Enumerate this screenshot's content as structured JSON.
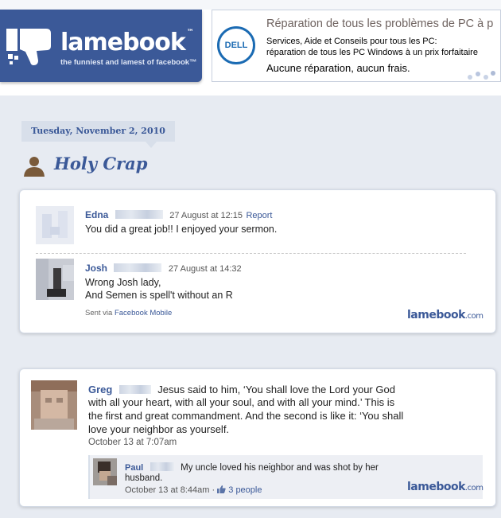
{
  "header": {
    "logo_text": "lamebook",
    "logo_tm": "™",
    "tagline": "the funniest and lamest of facebook™",
    "accent": "#3b5998"
  },
  "ad": {
    "brand": "DELL",
    "title": "Réparation de tous les problèmes de PC à p",
    "line1": "Services, Aide et Conseils pour tous les PC:",
    "line2": "réparation de tous les PC Windows à un prix forfaitaire",
    "cta": "Aucune réparation, aucun frais."
  },
  "post": {
    "date": "Tuesday, November 2, 2010",
    "title": "Holy Crap",
    "icon": "person-silhouette-icon"
  },
  "card1": {
    "comment1": {
      "name": "Edna",
      "time": "27 August at 12:15",
      "report": "Report",
      "text": "You did a great job!! I enjoyed your sermon."
    },
    "comment2": {
      "name": "Josh",
      "time": "27 August at 14:32",
      "line1": "Wrong Josh lady,",
      "line2": "And Semen is spell't without an R"
    },
    "sent_via": "Sent via",
    "sent_link": "Facebook Mobile",
    "watermark": "lamebook",
    "watermark_suffix": ".com"
  },
  "card2": {
    "status": {
      "name": "Greg",
      "text_first": "Jesus said to him, ‘You shall love the Lord your God",
      "text_lines": [
        "with all your heart, with all your soul, and with all your mind.’ This is",
        "the first and great commandment. And the second is like it: ‘You shall",
        "love your neighbor as yourself."
      ],
      "time": "October 13 at 7:07am"
    },
    "reply": {
      "name": "Paul",
      "text_first": "My uncle loved his neighbor and was shot by her",
      "text_second": "husband.",
      "time": "October 13 at 8:44am",
      "sep": "·",
      "likes": "3 people"
    },
    "watermark": "lamebook",
    "watermark_suffix": ".com"
  }
}
